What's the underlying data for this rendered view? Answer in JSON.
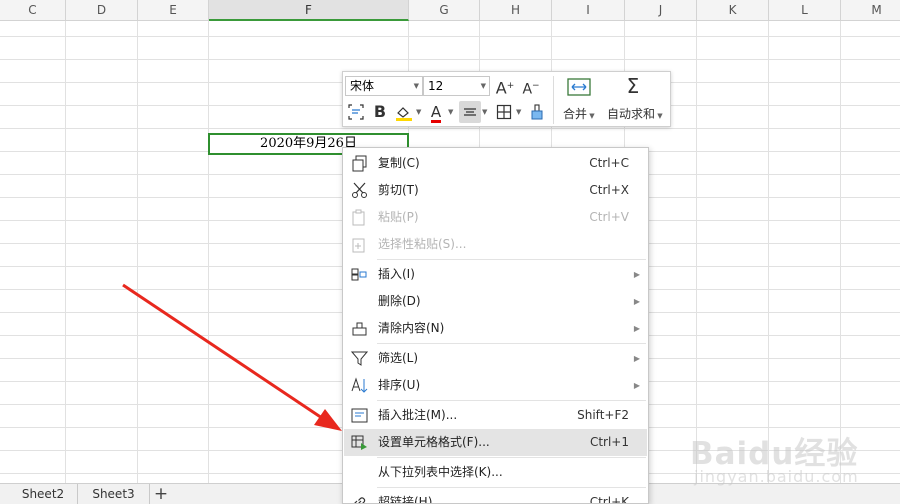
{
  "columns": [
    "C",
    "D",
    "E",
    "F",
    "G",
    "H",
    "I",
    "J",
    "K",
    "L",
    "M"
  ],
  "selected_column": "F",
  "active_cell_value": "2020年9月26日",
  "toolbar": {
    "font_name": "宋体",
    "font_size": "12",
    "grow_font_label": "A",
    "shrink_font_label": "A",
    "bold_label": "B",
    "font_color_label": "A",
    "font_color": "#e60000",
    "fill_color": "#ffd800",
    "merge_label": "合并",
    "autosum_label": "自动求和"
  },
  "context_menu": {
    "items": [
      {
        "label": "复制(C)",
        "shortcut": "Ctrl+C",
        "icon": "copy-icon",
        "disabled": false
      },
      {
        "label": "剪切(T)",
        "shortcut": "Ctrl+X",
        "icon": "scissors-icon",
        "disabled": false
      },
      {
        "label": "粘贴(P)",
        "shortcut": "Ctrl+V",
        "icon": "paste-icon",
        "disabled": true
      },
      {
        "label": "选择性粘贴(S)...",
        "shortcut": "",
        "icon": "paste-special-icon",
        "disabled": true
      },
      {
        "label": "插入(I)",
        "shortcut": "",
        "icon": "insert-cells-icon",
        "submenu": true
      },
      {
        "label": "删除(D)",
        "shortcut": "",
        "icon": "",
        "submenu": true
      },
      {
        "label": "清除内容(N)",
        "shortcut": "",
        "icon": "eraser-icon",
        "submenu": true
      },
      {
        "label": "筛选(L)",
        "shortcut": "",
        "icon": "filter-icon",
        "submenu": true
      },
      {
        "label": "排序(U)",
        "shortcut": "",
        "icon": "sort-icon",
        "submenu": true
      },
      {
        "label": "插入批注(M)...",
        "shortcut": "Shift+F2",
        "icon": "comment-icon"
      },
      {
        "label": "设置单元格格式(F)...",
        "shortcut": "Ctrl+1",
        "icon": "format-cells-icon",
        "highlighted": true
      },
      {
        "label": "从下拉列表中选择(K)...",
        "shortcut": "",
        "icon": ""
      },
      {
        "label": "超链接(H)...",
        "shortcut": "Ctrl+K",
        "icon": "link-icon"
      }
    ]
  },
  "sheet_tabs": [
    "Sheet2",
    "Sheet3"
  ],
  "add_sheet_label": "+",
  "annotation_arrow_color": "#e8281e",
  "watermark": {
    "logo": "Baidu经验",
    "sub": "jingyan.baidu.com"
  }
}
